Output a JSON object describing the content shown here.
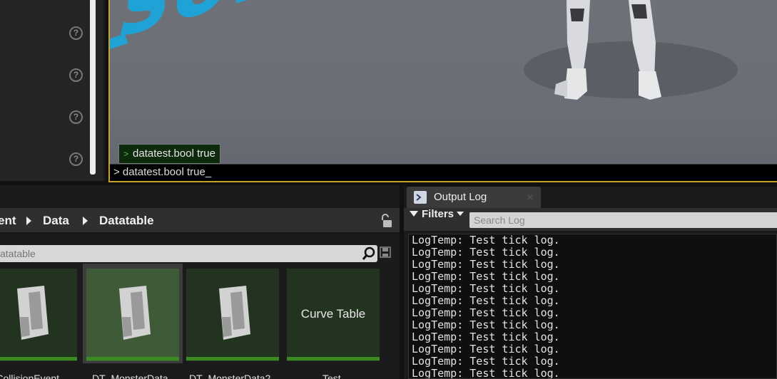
{
  "viewport": {
    "floor_text": "son",
    "console_suggestion_prompt": ">",
    "console_suggestion": "datatest.bool true",
    "console_input": "> datatest.bool true_"
  },
  "content_browser": {
    "breadcrumbs": [
      "ent",
      "Data",
      "Datatable"
    ],
    "search_text": "atatable",
    "assets": [
      {
        "label": "T_CollisionEvent",
        "type": "data-table",
        "selected": false
      },
      {
        "label": "DT_MonsterData",
        "type": "data-table",
        "selected": true
      },
      {
        "label": "DT_MonsterData2",
        "type": "data-table",
        "selected": false
      },
      {
        "label": "Test",
        "type": "curve-table",
        "thumb_text": "Curve Table",
        "selected": false
      }
    ]
  },
  "output_log": {
    "tab_label": "Output Log",
    "filters_label": "Filters",
    "search_placeholder": "Search Log",
    "lines": [
      "LogTemp: Test tick log.",
      "LogTemp: Test tick log.",
      "LogTemp: Test tick log.",
      "LogTemp: Test tick log.",
      "LogTemp: Test tick log.",
      "LogTemp: Test tick log.",
      "LogTemp: Test tick log.",
      "LogTemp: Test tick log.",
      "LogTemp: Test tick log.",
      "LogTemp: Test tick log.",
      "LogTemp: Test tick log.",
      "LogTemp: Test tick log."
    ]
  },
  "colors": {
    "viewport_border": "#c8a128",
    "floor_text": "#1fa3d6",
    "asset_bar": "#3c8a22"
  }
}
